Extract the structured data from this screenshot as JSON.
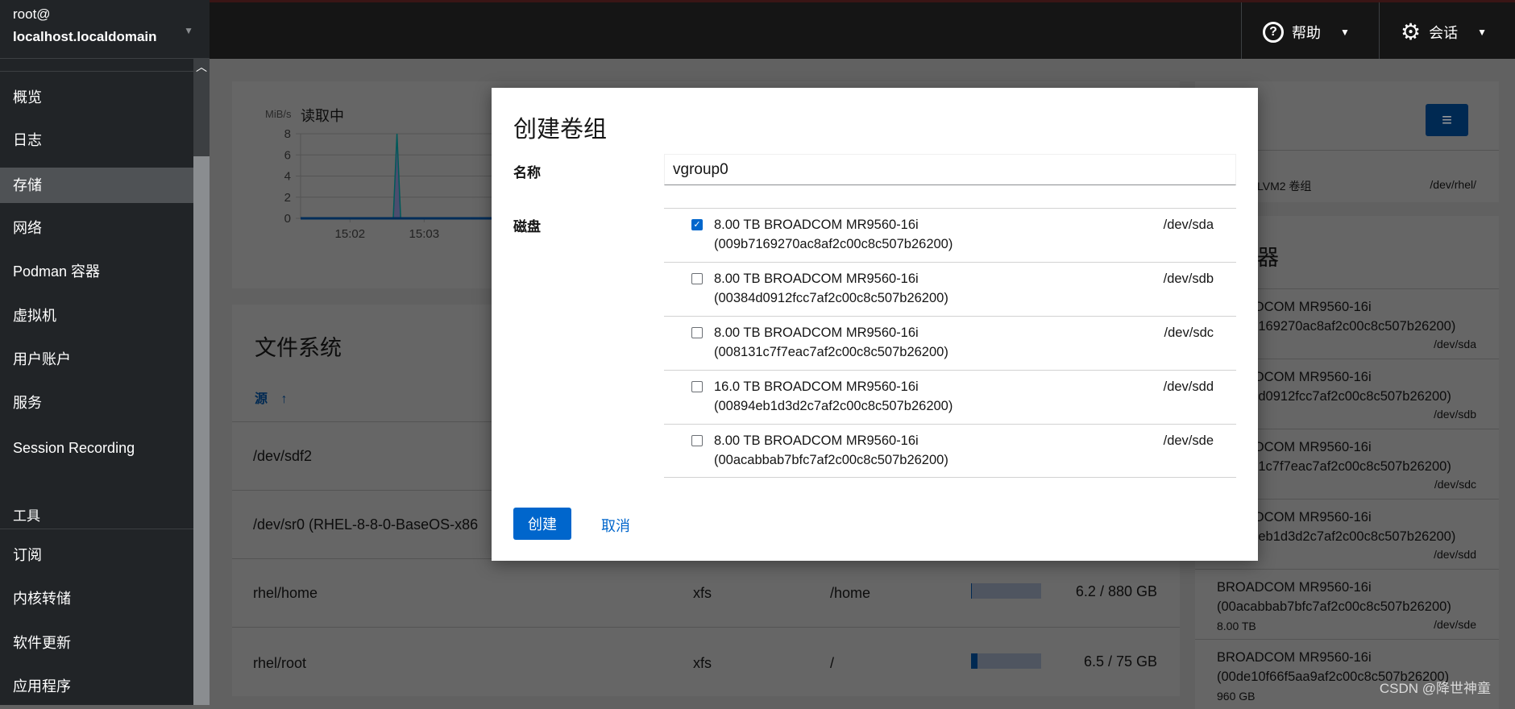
{
  "host": {
    "user": "root@",
    "name": "localhost.localdomain"
  },
  "header": {
    "help": "帮助",
    "session": "会话",
    "help_icon": "question-circle-icon",
    "session_icon": "gear-icon"
  },
  "sidebar": {
    "items": [
      {
        "label": "概览"
      },
      {
        "label": "日志"
      },
      {
        "label": "存储",
        "active": true
      },
      {
        "label": "网络"
      },
      {
        "label": "Podman 容器"
      },
      {
        "label": "虚拟机"
      },
      {
        "label": "用户账户"
      },
      {
        "label": "服务"
      },
      {
        "label": "Session Recording"
      }
    ],
    "tools_heading": "工具",
    "tools": [
      {
        "label": "订阅"
      },
      {
        "label": "内核转储"
      },
      {
        "label": "软件更新"
      },
      {
        "label": "应用程序"
      }
    ]
  },
  "chart": {
    "unit": "MiB/s",
    "title": "读取中"
  },
  "chart_data": {
    "type": "area",
    "title": "读取中",
    "ylabel": "MiB/s",
    "ylim": [
      0,
      8
    ],
    "yticks": [
      "0",
      "2",
      "4",
      "6",
      "8"
    ],
    "xticks": [
      "15:02",
      "15:03",
      "15"
    ],
    "x": [
      "15:01:40",
      "15:02:35",
      "15:02:38",
      "15:02:41",
      "15:03:30"
    ],
    "values": [
      0,
      0,
      8,
      0,
      0
    ],
    "grid": true
  },
  "filesystems": {
    "title": "文件系统",
    "sort_col": "源",
    "rows": [
      {
        "source": "/dev/sdf2"
      },
      {
        "source": "/dev/sr0 (RHEL-8-8-0-BaseOS-x86"
      },
      {
        "source": "rhel/home",
        "type": "xfs",
        "mount": "/home",
        "usage": "6.2 / 880 GB",
        "fraction": 0.007
      },
      {
        "source": "rhel/root",
        "type": "xfs",
        "mount": "/",
        "usage": "6.5 / 75 GB",
        "fraction": 0.087
      }
    ]
  },
  "right": {
    "vg_type": "LVM2 卷组",
    "vg_path": "/dev/rhel/",
    "drives_title": "器",
    "drives": [
      {
        "name": "BROADCOM MR9560-16i",
        "id": "(009b7169270ac8af2c00c8c507b26200)",
        "dev": "/dev/sda"
      },
      {
        "name": "BROADCOM MR9560-16i",
        "id": "(00384d0912fcc7af2c00c8c507b26200)",
        "dev": "/dev/sdb"
      },
      {
        "name": "BROADCOM MR9560-16i",
        "id": "(008131c7f7eac7af2c00c8c507b26200)",
        "dev": "/dev/sdc"
      },
      {
        "name": "BROADCOM MR9560-16i",
        "id": "(00894eb1d3d2c7af2c00c8c507b26200)",
        "dev": "/dev/sdd"
      },
      {
        "name": "BROADCOM MR9560-16i",
        "id": "(00acabbab7bfc7af2c00c8c507b26200)",
        "size": "8.00 TB",
        "dev": "/dev/sde"
      },
      {
        "name": "BROADCOM MR9560-16i",
        "id": "(00de10f66f5aa9af2c00c8c507b26200)",
        "size": "960 GB"
      }
    ]
  },
  "modal": {
    "title": "创建卷组",
    "name_label": "名称",
    "name_value": "vgroup0",
    "disks_label": "磁盘",
    "disks": [
      {
        "label": "8.00 TB BROADCOM MR9560-16i",
        "id": "(009b7169270ac8af2c00c8c507b26200)",
        "dev": "/dev/sda",
        "checked": true
      },
      {
        "label": "8.00 TB BROADCOM MR9560-16i",
        "id": "(00384d0912fcc7af2c00c8c507b26200)",
        "dev": "/dev/sdb",
        "checked": false
      },
      {
        "label": "8.00 TB BROADCOM MR9560-16i",
        "id": "(008131c7f7eac7af2c00c8c507b26200)",
        "dev": "/dev/sdc",
        "checked": false
      },
      {
        "label": "16.0 TB BROADCOM MR9560-16i",
        "id": "(00894eb1d3d2c7af2c00c8c507b26200)",
        "dev": "/dev/sdd",
        "checked": false
      },
      {
        "label": "8.00 TB BROADCOM MR9560-16i",
        "id": "(00acabbab7bfc7af2c00c8c507b26200)",
        "dev": "/dev/sde",
        "checked": false
      }
    ],
    "create": "创建",
    "cancel": "取消"
  },
  "watermark": "CSDN @降世神童",
  "colors": {
    "primary": "#0066cc",
    "sidebar": "#212427",
    "header": "#151515"
  }
}
